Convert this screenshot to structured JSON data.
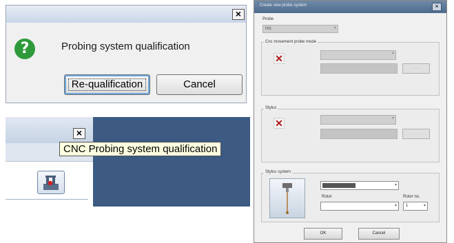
{
  "qualification_dialog": {
    "close_glyph": "×",
    "question_glyph": "?",
    "message": "Probing system qualification",
    "requalify_label": "Re-qualification",
    "cancel_label": "Cancel"
  },
  "toolbar_panel": {
    "close_glyph": "×",
    "tooltip": "CNC Probing system qualification",
    "button_icon": "probe-icon"
  },
  "create_dialog": {
    "title": "Create new probe system",
    "probe_label": "Probe",
    "probe_value": "NN",
    "module_group_label": "Cnc movement probe mode",
    "stylus_group_label": "Stylus",
    "stylus_system_label": "Stylus system",
    "stylus_combo_value": "",
    "rotor_label": "Rotor",
    "rotor_no_label": "Rotor no.",
    "rotor_no_value": "1",
    "small_button_label": "...",
    "ok_label": "OK",
    "cancel_label": "Cancel",
    "error_icon": "x-icon"
  },
  "colors": {
    "desktop_bg": "#3c5a82",
    "question_icon": "#2e9a3a",
    "tooltip_bg": "#ffffe1"
  }
}
